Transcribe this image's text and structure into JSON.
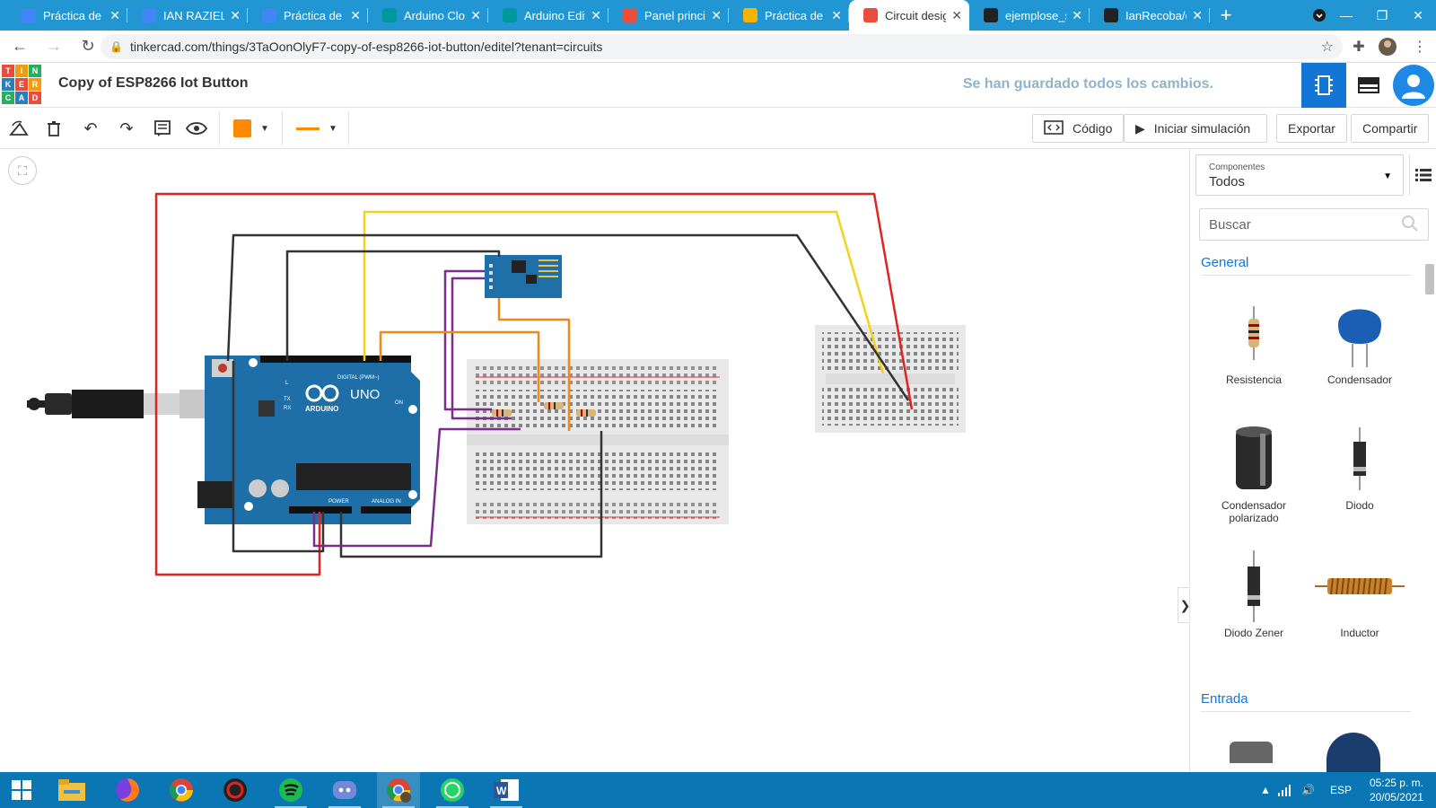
{
  "browser": {
    "tabs": [
      {
        "title": "Práctica de co",
        "icon": "docs-icon",
        "color": "#4285f4"
      },
      {
        "title": "IAN RAZIEL RA",
        "icon": "docs-icon",
        "color": "#4285f4"
      },
      {
        "title": "Práctica de so",
        "icon": "docs-icon",
        "color": "#4285f4"
      },
      {
        "title": "Arduino Cloud",
        "icon": "arduino-icon",
        "color": "#00979d"
      },
      {
        "title": "Arduino Edito",
        "icon": "arduino-icon",
        "color": "#00979d"
      },
      {
        "title": "Panel principa",
        "icon": "tinkercad-icon",
        "color": "#e94e3c"
      },
      {
        "title": "Práctica de di",
        "icon": "hand-icon",
        "color": "#f5b400"
      },
      {
        "title": "Circuit design",
        "icon": "tinkercad-icon",
        "color": "#e94e3c",
        "active": true
      },
      {
        "title": "ejemplose_sp",
        "icon": "github-icon",
        "color": "#222222"
      },
      {
        "title": "IanRecoba/es",
        "icon": "github-icon",
        "color": "#222222"
      }
    ],
    "url": "tinkercad.com/things/3TaOonOlyF7-copy-of-esp8266-iot-button/editel?tenant=circuits"
  },
  "app": {
    "logo_letters": [
      "T",
      "I",
      "N",
      "K",
      "E",
      "R",
      "C",
      "A",
      "D"
    ],
    "project_title": "Copy of ESP8266 Iot Button",
    "save_status": "Se han guardado todos los cambios."
  },
  "toolbar": {
    "code_label": "Código",
    "simulate_label": "Iniciar simulación",
    "export_label": "Exportar",
    "share_label": "Compartir",
    "color": "#ff8a00"
  },
  "board": {
    "uno_label": "UNO",
    "arduino_label": "ARDUINO",
    "digital_label": "DIGITAL (PWM~)",
    "power_label": "POWER",
    "analog_label": "ANALOG IN",
    "on_label": "ON",
    "pin_labels": [
      "AREF",
      "GND",
      "13",
      "12",
      "~11",
      "~10",
      "~9",
      "8",
      "7",
      "~6",
      "~5",
      "4",
      "~3",
      "2",
      "TX→1",
      "RX←0"
    ],
    "power_pins": [
      "IOREF",
      "RESET",
      "3.3V",
      "5V",
      "GND",
      "GND",
      "Vin"
    ],
    "analog_pins": [
      "A0",
      "A1",
      "A2",
      "A3",
      "A4",
      "A5"
    ],
    "tx_label": "TX",
    "rx_label": "RX",
    "l_label": "L"
  },
  "panel": {
    "components_label": "Componentes",
    "components_value": "Todos",
    "search_placeholder": "Buscar",
    "section_general": "General",
    "section_input": "Entrada",
    "items": [
      {
        "name": "Resistencia"
      },
      {
        "name": "Condensador"
      },
      {
        "name": "Condensador polarizado"
      },
      {
        "name": "Diodo"
      },
      {
        "name": "Diodo Zener"
      },
      {
        "name": "Inductor"
      }
    ]
  },
  "taskbar": {
    "apps": [
      "windows-start-icon",
      "file-explorer-icon",
      "firefox-icon",
      "chrome-icon",
      "media-app-icon",
      "spotify-icon",
      "discord-icon",
      "chrome-profile-icon",
      "whatsapp-icon",
      "word-icon"
    ],
    "language": "ESP",
    "time": "05:25 p. m.",
    "date": "20/05/2021"
  }
}
